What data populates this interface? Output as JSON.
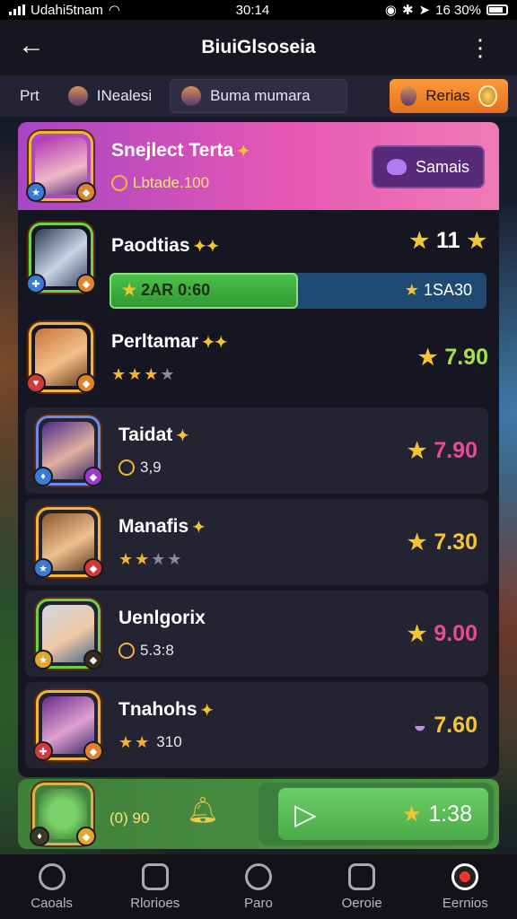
{
  "status_bar": {
    "carrier": "Udahi5tnam",
    "time": "30:14",
    "battery_text": "16 30%"
  },
  "header": {
    "title": "BiuiGlsoseia"
  },
  "filters": {
    "chip1_label": "Prt",
    "chip2_label": "INealesi",
    "chip3_label": "Buma mumara",
    "chip4_label": "Rerias"
  },
  "rows": [
    {
      "name": "Snejlect Terta",
      "sub": "Lbtade.100",
      "action_label": "Samais"
    },
    {
      "name": "Paodtias",
      "score": "11",
      "progress_left": "2AR 0:60",
      "progress_right": "1SA30",
      "progress_pct": 0.5
    },
    {
      "name": "Perltamar",
      "stars": 3,
      "score": "7.90"
    },
    {
      "name": "Taidat",
      "sub": "3,9",
      "score": "7.90"
    },
    {
      "name": "Manafis",
      "stars": 2,
      "score": "7.30"
    },
    {
      "name": "Uenlgorix",
      "sub": "5.3:8",
      "score": "9.00"
    },
    {
      "name": "Tnahohs",
      "stars": 2,
      "sub": "310",
      "score": "7.60"
    }
  ],
  "promo": {
    "text": "(0) 90",
    "value": "1:38"
  },
  "tabs": [
    "Caoals",
    "Rlorioes",
    "Paro",
    "Oeroie",
    "Eernios"
  ],
  "colors": {
    "accent_pink": "#e557b3",
    "accent_green": "#4e9a44",
    "accent_orange": "#ff9a3c"
  }
}
